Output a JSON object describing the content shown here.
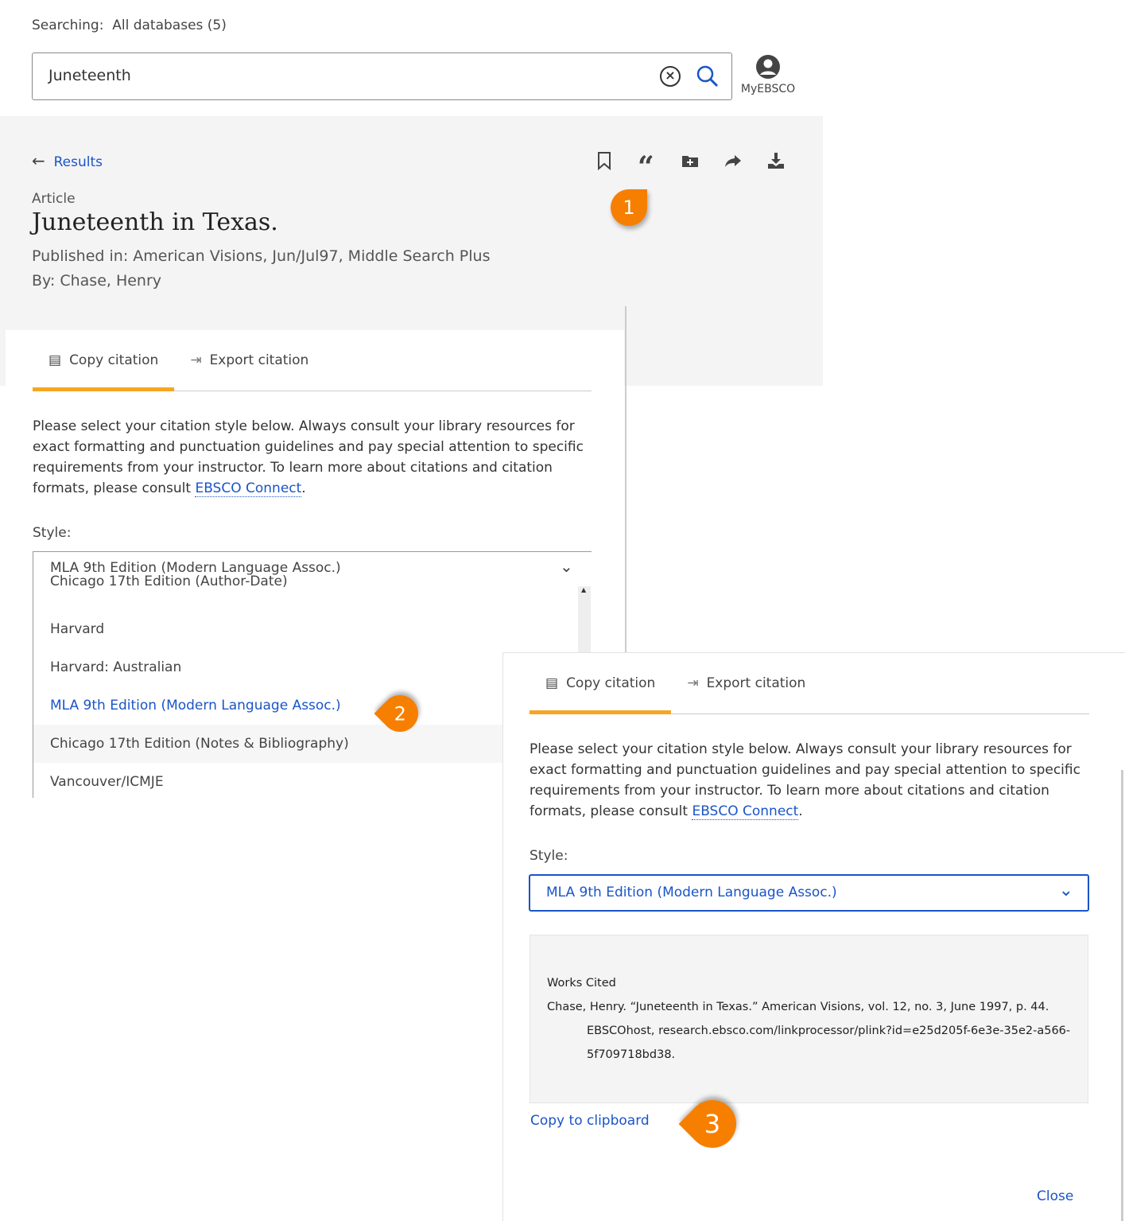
{
  "search": {
    "scope_label": "Searching:",
    "scope_value": "All databases (5)",
    "query": "Juneteenth",
    "account_label": "MyEBSCO"
  },
  "record": {
    "back_label": "Results",
    "type": "Article",
    "title": "Juneteenth in Texas.",
    "published": "Published in: American Visions, Jun/Jul97, Middle Search Plus",
    "by": "By: Chase, Henry",
    "toolbar": [
      "bookmark-icon",
      "cite-quote-icon",
      "add-to-folder-icon",
      "share-icon",
      "download-icon"
    ]
  },
  "citation_panel": {
    "tabs": [
      {
        "label": "Copy citation",
        "icon": "copy-icon"
      },
      {
        "label": "Export citation",
        "icon": "export-icon"
      }
    ],
    "intro": "Please select your citation style below. Always consult your library resources for exact formatting and punctuation guidelines and pay special attention to specific requirements from your instructor. To learn more about citations and citation formats, please consult ",
    "intro_link": "EBSCO Connect",
    "intro_end": ".",
    "style_label": "Style:",
    "selected_style": "MLA 9th Edition (Modern Language Assoc.)",
    "options": [
      "Chicago 17th Edition (Author-Date)",
      "Harvard",
      "Harvard: Australian",
      "MLA 9th Edition (Modern Language Assoc.)",
      "Chicago 17th Edition (Notes & Bibliography)",
      "Vancouver/ICMJE"
    ],
    "citation": {
      "heading": "Works Cited",
      "line1": "Chase, Henry. “Juneteenth in Texas.” American Visions, vol. 12, no. 3, June 1997, p. 44.",
      "line2": "EBSCOhost, research.ebsco.com/linkprocessor/plink?id=e25d205f-6e3e-35e2-a566-",
      "line3": "5f709718bd38."
    },
    "copy_label": "Copy to clipboard",
    "close_label": "Close"
  },
  "callouts": [
    "1",
    "2",
    "3"
  ],
  "colors": {
    "accent": "#1a54c8",
    "tab_underline": "#f6a623",
    "callout": "#f77f00"
  }
}
